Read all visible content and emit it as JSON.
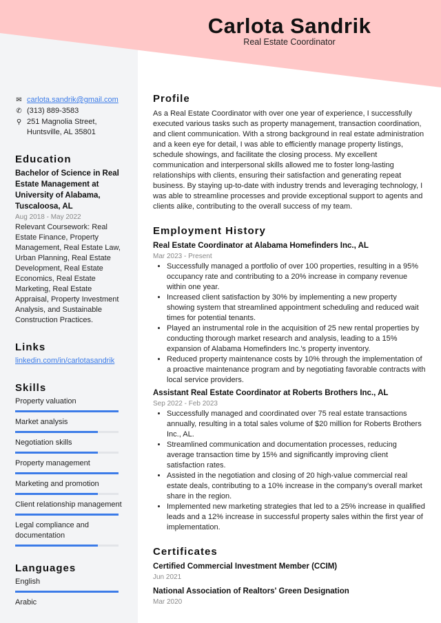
{
  "header": {
    "name": "Carlota Sandrik",
    "title": "Real Estate Coordinator",
    "banner_color": "#ffc8c8",
    "sidebar_color": "#f3f4f6",
    "accent": "#3b7be8"
  },
  "contact": {
    "email": "carlota.sandrik@gmail.com",
    "phone": "(313) 889-3583",
    "address": "251 Magnolia Street, Huntsville, AL 35801"
  },
  "education": {
    "heading": "Education",
    "degree": "Bachelor of Science in Real Estate Management at University of Alabama, Tuscaloosa, AL",
    "dates": "Aug 2018 - May 2022",
    "coursework": "Relevant Coursework: Real Estate Finance, Property Management, Real Estate Law, Urban Planning, Real Estate Development, Real Estate Economics, Real Estate Marketing, Real Estate Appraisal, Property Investment Analysis, and Sustainable Construction Practices."
  },
  "links": {
    "heading": "Links",
    "items": [
      "linkedin.com/in/carlotasandrik"
    ]
  },
  "skills": {
    "heading": "Skills",
    "items": [
      {
        "name": "Property valuation",
        "level": 100
      },
      {
        "name": "Market analysis",
        "level": 80
      },
      {
        "name": "Negotiation skills",
        "level": 80
      },
      {
        "name": "Property management",
        "level": 100
      },
      {
        "name": "Marketing and promotion",
        "level": 80
      },
      {
        "name": "Client relationship management",
        "level": 100
      },
      {
        "name": "Legal compliance and documentation",
        "level": 80
      }
    ]
  },
  "languages": {
    "heading": "Languages",
    "items": [
      {
        "name": "English",
        "level": 100
      },
      {
        "name": "Arabic"
      }
    ]
  },
  "profile": {
    "heading": "Profile",
    "text": "As a Real Estate Coordinator with over one year of experience, I successfully executed various tasks such as property management, transaction coordination, and client communication. With a strong background in real estate administration and a keen eye for detail, I was able to efficiently manage property listings, schedule showings, and facilitate the closing process. My excellent communication and interpersonal skills allowed me to foster long-lasting relationships with clients, ensuring their satisfaction and generating repeat business. By staying up-to-date with industry trends and leveraging technology, I was able to streamline processes and provide exceptional support to agents and clients alike, contributing to the overall success of my team."
  },
  "employment": {
    "heading": "Employment History",
    "jobs": [
      {
        "title": "Real Estate Coordinator at Alabama Homefinders Inc., AL",
        "dates": "Mar 2023 - Present",
        "bullets": [
          "Successfully managed a portfolio of over 100 properties, resulting in a 95% occupancy rate and contributing to a 20% increase in company revenue within one year.",
          "Increased client satisfaction by 30% by implementing a new property showing system that streamlined appointment scheduling and reduced wait times for potential tenants.",
          "Played an instrumental role in the acquisition of 25 new rental properties by conducting thorough market research and analysis, leading to a 15% expansion of Alabama Homefinders Inc.'s property inventory.",
          "Reduced property maintenance costs by 10% through the implementation of a proactive maintenance program and by negotiating favorable contracts with local service providers."
        ]
      },
      {
        "title": "Assistant Real Estate Coordinator at Roberts Brothers Inc., AL",
        "dates": "Sep 2022 - Feb 2023",
        "bullets": [
          "Successfully managed and coordinated over 75 real estate transactions annually, resulting in a total sales volume of $20 million for Roberts Brothers Inc., AL.",
          "Streamlined communication and documentation processes, reducing average transaction time by 15% and significantly improving client satisfaction rates.",
          "Assisted in the negotiation and closing of 20 high-value commercial real estate deals, contributing to a 10% increase in the company's overall market share in the region.",
          "Implemented new marketing strategies that led to a 25% increase in qualified leads and a 12% increase in successful property sales within the first year of implementation."
        ]
      }
    ]
  },
  "certificates": {
    "heading": "Certificates",
    "items": [
      {
        "name": "Certified Commercial Investment Member (CCIM)",
        "date": "Jun 2021"
      },
      {
        "name": "National Association of Realtors' Green Designation",
        "date": "Mar 2020"
      }
    ]
  }
}
